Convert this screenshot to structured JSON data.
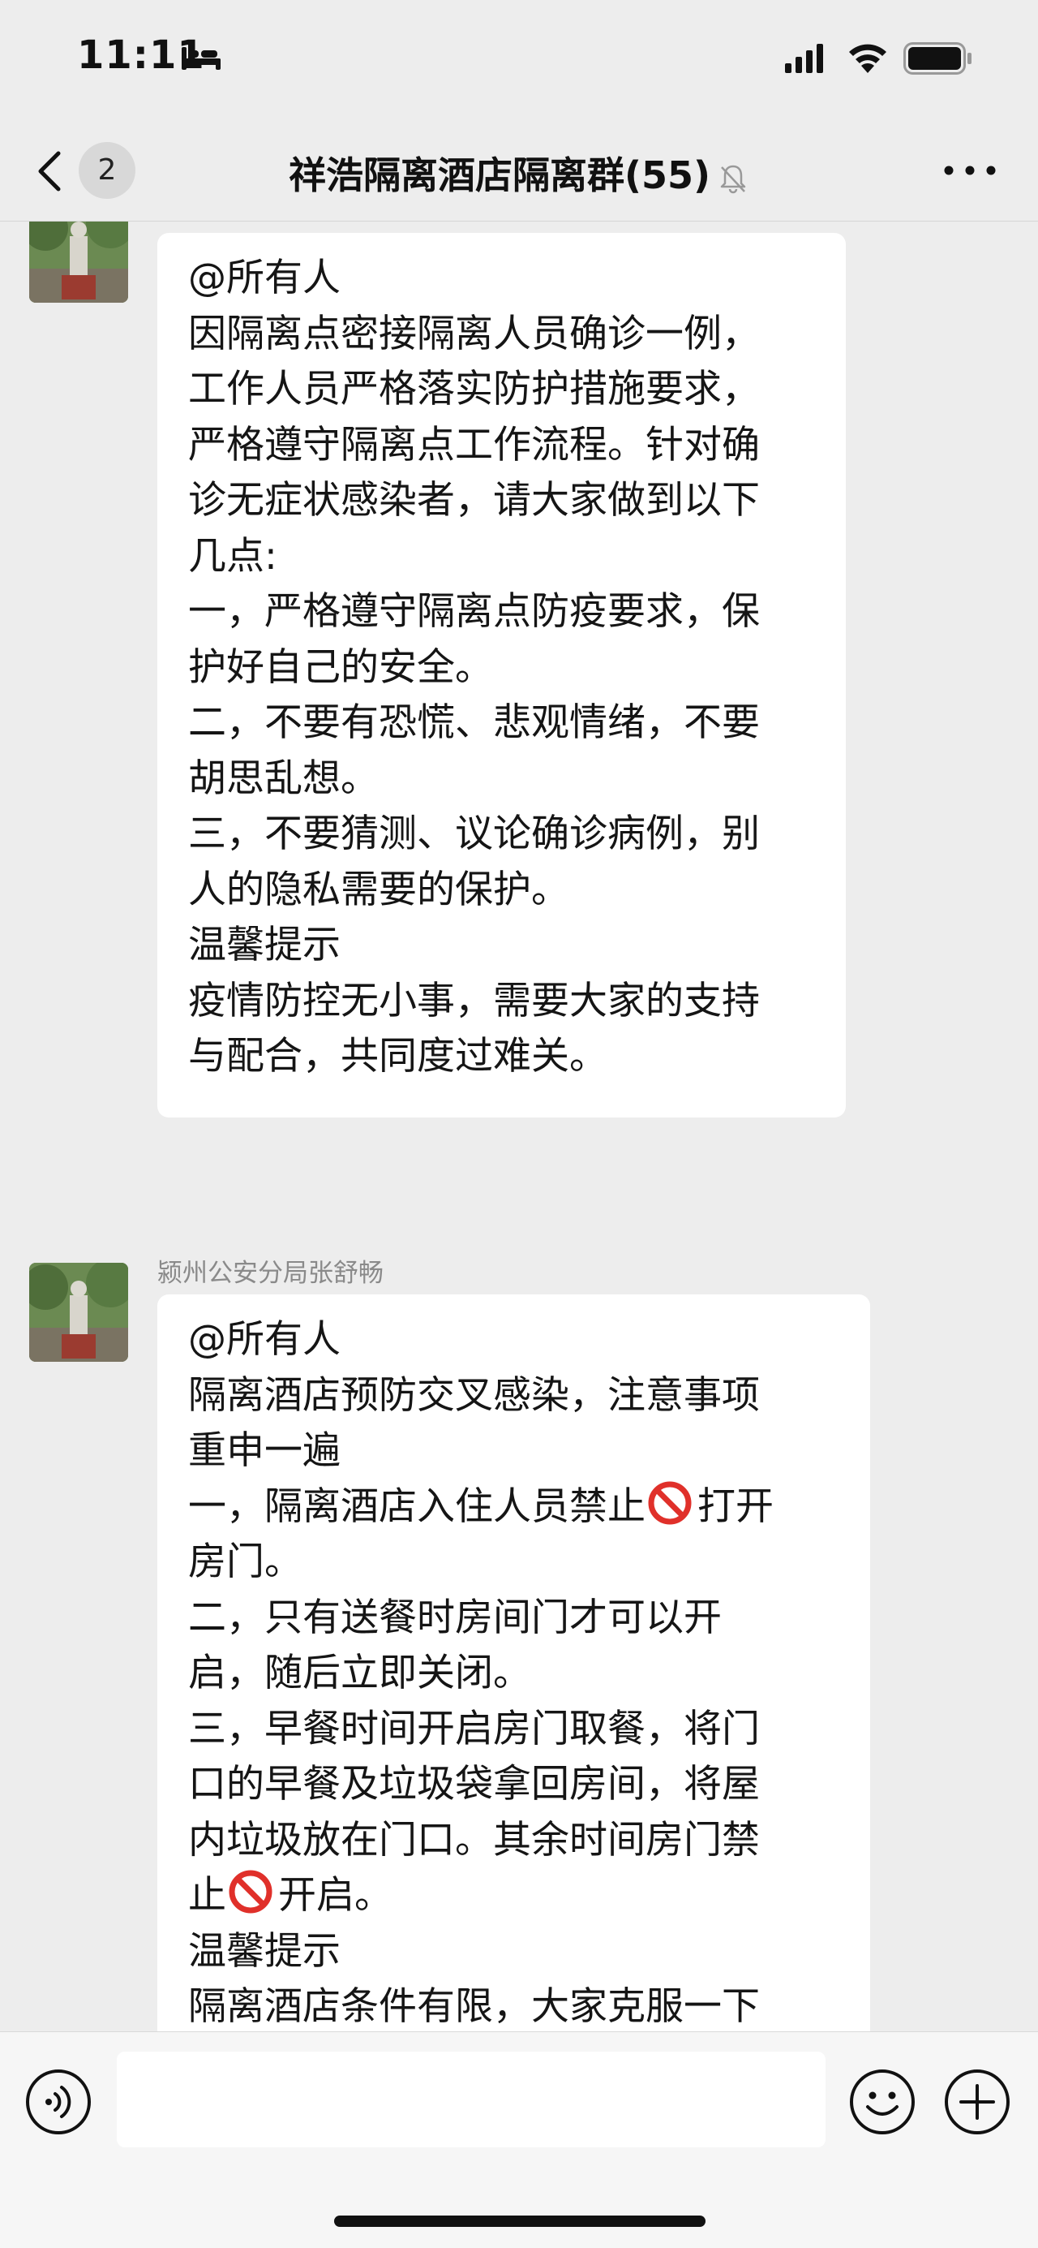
{
  "status_bar": {
    "time": "11:11"
  },
  "nav": {
    "unread_count": "2",
    "title": "祥浩隔离酒店隔离群(55)"
  },
  "messages": [
    {
      "sender": "",
      "lines": [
        "@所有人",
        "因隔离点密接隔离人员确诊一例，",
        "工作人员严格落实防护措施要求，",
        "严格遵守隔离点工作流程。针对确",
        "诊无症状感染者，请大家做到以下",
        "几点:",
        "一，严格遵守隔离点防疫要求，保",
        "护好自己的安全。",
        "二，不要有恐慌、悲观情绪，不要",
        "胡思乱想。",
        "三，不要猜测、议论确诊病例，别",
        "人的隐私需要的保护。",
        "温馨提示",
        "疫情防控无小事，需要大家的支持",
        "与配合，共同度过难关。"
      ]
    },
    {
      "sender": "颍州公安分局张舒畅",
      "lines": [
        "@所有人",
        "隔离酒店预防交叉感染，注意事项",
        "重申一遍",
        "一，隔离酒店入住人员禁止",
        "打开",
        "房门。",
        "二，只有送餐时房间门才可以开",
        "启，随后立即关闭。",
        "三，早餐时间开启房门取餐，将门",
        "口的早餐及垃圾袋拿回房间，将屋",
        "内垃圾放在门口。其余时间房门禁",
        "止",
        "开启。",
        "温馨提示",
        "隔离酒店条件有限，大家克服一下"
      ]
    }
  ],
  "input": {
    "placeholder": ""
  }
}
